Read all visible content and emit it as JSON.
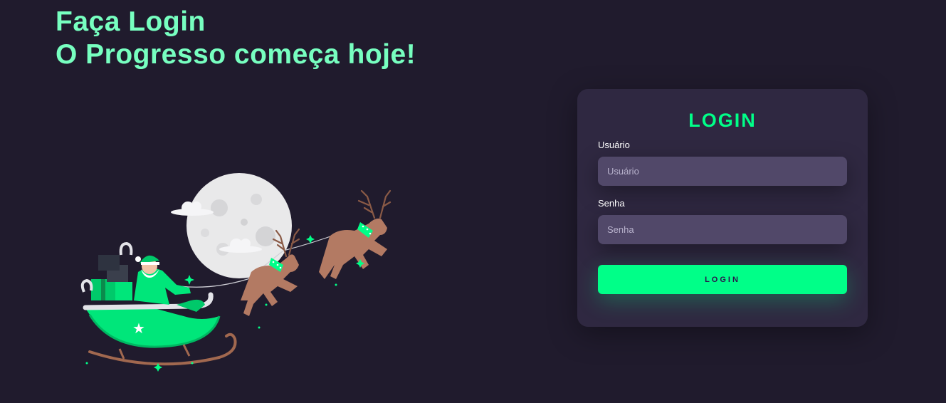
{
  "hero": {
    "line1": "Faça Login",
    "line2": "O Progresso começa hoje!"
  },
  "illustration": {
    "subject": "santa-sleigh-with-reindeer-and-moon"
  },
  "login_card": {
    "title": "LOGIN",
    "username_label": "Usuário",
    "username_placeholder": "Usuário",
    "password_label": "Senha",
    "password_placeholder": "Senha",
    "submit_label": "LOGIN"
  },
  "colors": {
    "background": "#201b2d",
    "card": "#2f2841",
    "input": "#514869",
    "accent": "#00ff88",
    "headline": "#77ffc0"
  }
}
